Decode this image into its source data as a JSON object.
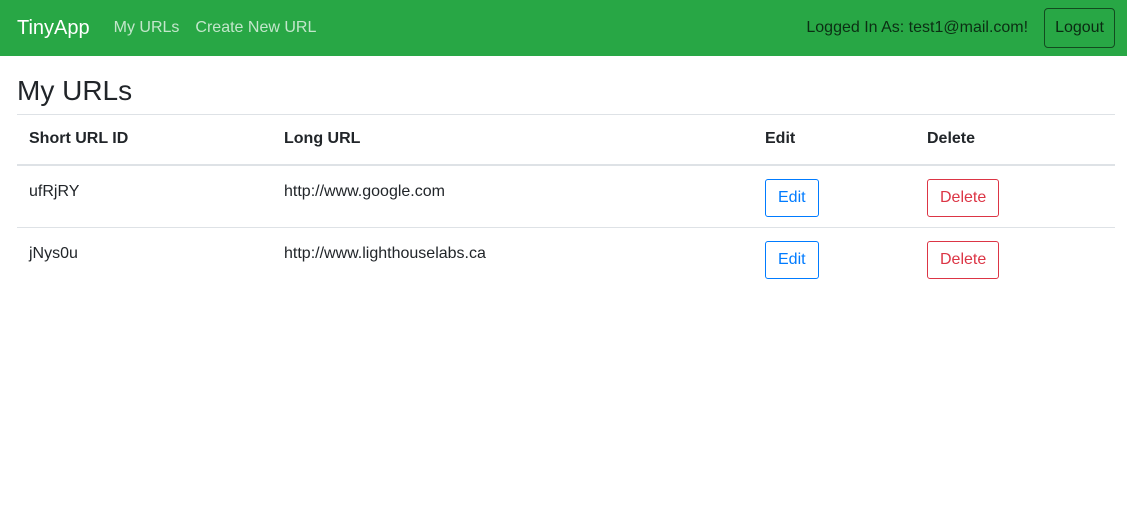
{
  "navbar": {
    "brand": "TinyApp",
    "links": [
      {
        "label": "My URLs"
      },
      {
        "label": "Create New URL"
      }
    ],
    "logged_in_text": "Logged In As: test1@mail.com!",
    "logout_label": "Logout",
    "bg_color": "#28a745"
  },
  "main": {
    "title": "My URLs",
    "table": {
      "headers": [
        "Short URL ID",
        "Long URL",
        "Edit",
        "Delete"
      ],
      "rows": [
        {
          "short_id": "ufRjRY",
          "long_url": "http://www.google.com",
          "edit_label": "Edit",
          "delete_label": "Delete"
        },
        {
          "short_id": "jNys0u",
          "long_url": "http://www.lighthouselabs.ca",
          "edit_label": "Edit",
          "delete_label": "Delete"
        }
      ]
    }
  },
  "colors": {
    "edit": "#007bff",
    "delete": "#dc3545"
  }
}
